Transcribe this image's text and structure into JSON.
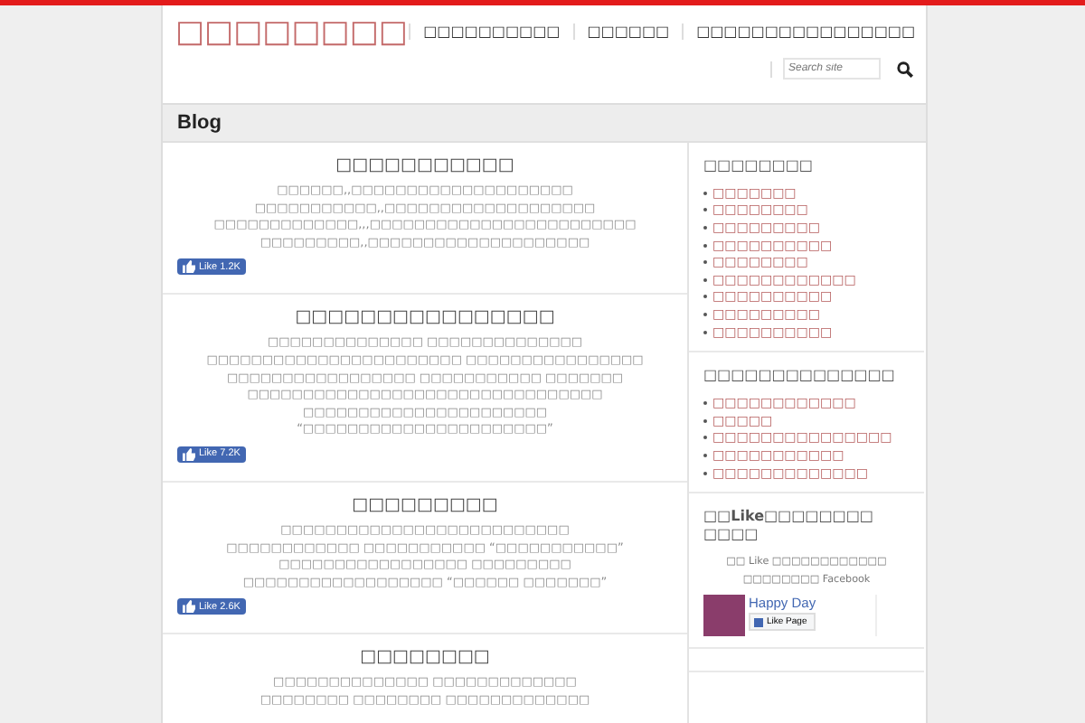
{
  "header": {
    "logo": "□□□□□□□□",
    "nav": [
      "□□□□□□□□□□",
      "□□□□□□",
      "□□□□□□□□□□□□□□□□"
    ],
    "search": {
      "placeholder": "Search site"
    }
  },
  "page_title": "Blog",
  "posts": [
    {
      "title": "□□□□□□□□□□□",
      "excerpt": "□□□□□□,,□□□□□□□□□□□□□□□□□□□□\n□□□□□□□□□□□,,□□□□□□□□□□□□□□□□□□□\n□□□□□□□□□□□□□,,,□□□□□□□□□□□□□□□□□□□□□□□□\n□□□□□□□□□,,□□□□□□□□□□□□□□□□□□□□",
      "like": {
        "label": "Like",
        "count": "1.2K"
      }
    },
    {
      "title": "□□□□□□□□□□□□□□□□",
      "excerpt": "□□□□□□□□□□□□□□ □□□□□□□□□□□□□□\n□□□□□□□□□□□□□□□□□□□□□□□ □□□□□□□□□□□□□□□□\n□□□□□□□□□□□□□□□□□ □□□□□□□□□□□ □□□□□□□\n□□□□□□□□□□□□□□□□□□□□□□□□□□□□□□□□\n□□□□□□□□□□□□□□□□□□□□□□ “□□□□□□□□□□□□□□□□□□□□□□”",
      "like": {
        "label": "Like",
        "count": "7.2K"
      }
    },
    {
      "title": "□□□□□□□□□",
      "excerpt": "□□□□□□□□□□□□□□□□□□□□□□□□□□\n□□□□□□□□□□□□ □□□□□□□□□□□ “□□□□□□□□□□□”\n□□□□□□□□□□□□□□□□□ □□□□□□□□□\n□□□□□□□□□□□□□□□□□□ “□□□□□□ □□□□□□□”",
      "like": {
        "label": "Like",
        "count": "2.6K"
      }
    },
    {
      "title": "□□□□□□□□",
      "excerpt": "□□□□□□□□□□□□□□ □□□□□□□□□□□□□\n□□□□□□□□ □□□□□□□□ □□□□□□□□□□□□□"
    }
  ],
  "sidebar": {
    "widgets": [
      {
        "kind": "links",
        "title": "□□□□□□□□",
        "items": [
          "□□□□□□□",
          "□□□□□□□□",
          "□□□□□□□□□",
          "□□□□□□□□□□",
          "□□□□□□□□",
          "□□□□□□□□□□□□",
          "□□□□□□□□□□",
          "□□□□□□□□□",
          "□□□□□□□□□□"
        ]
      },
      {
        "kind": "links",
        "title": "□□□□□□□□□□□□□□",
        "items": [
          "□□□□□□□□□□□□",
          "□□□□□",
          "□□□□□□□□□□□□□□□",
          "□□□□□□□□□□□",
          "□□□□□□□□□□□□□"
        ]
      },
      {
        "kind": "facebook",
        "title": "□□**Like**□□□□□□□□ □□□□",
        "text": "□□ Like □□□□□□□□□□□□ □□□□□□□□ Facebook",
        "page_name": "Happy Day",
        "button": "Like Page"
      }
    ]
  }
}
